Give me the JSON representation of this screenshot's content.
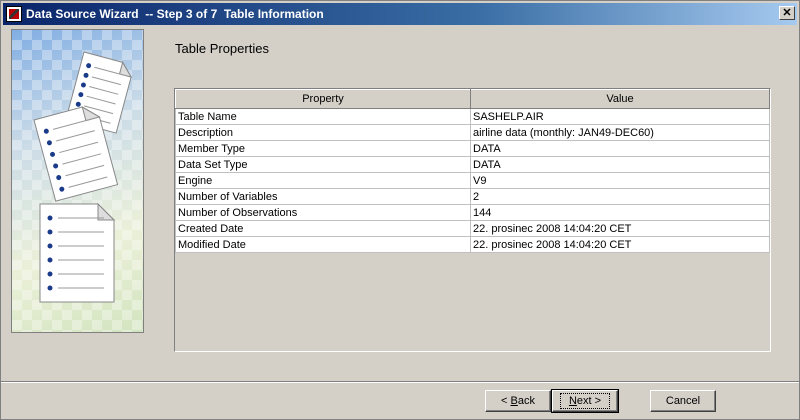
{
  "window": {
    "title": "Data Source Wizard  -- Step 3 of 7  Table Information",
    "close_label": "✕"
  },
  "heading": "Table Properties",
  "table": {
    "columns": [
      "Property",
      "Value"
    ],
    "rows": [
      [
        "Table Name",
        "SASHELP.AIR"
      ],
      [
        "Description",
        "airline data (monthly: JAN49-DEC60)"
      ],
      [
        "Member Type",
        "DATA"
      ],
      [
        "Data Set Type",
        "DATA"
      ],
      [
        "Engine",
        "V9"
      ],
      [
        "Number of Variables",
        "2"
      ],
      [
        "Number of Observations",
        "144"
      ],
      [
        "Created Date",
        "22. prosinec 2008 14:04:20 CET"
      ],
      [
        "Modified Date",
        "22. prosinec 2008 14:04:20 CET"
      ]
    ]
  },
  "buttons": {
    "back_pre": "< ",
    "back_hot": "B",
    "back_post": "ack",
    "next_hot": "N",
    "next_post": "ext >",
    "cancel": "Cancel"
  },
  "icons": {
    "app": "sas-app-icon",
    "close": "close-icon",
    "illustration": "document-stack-illustration"
  },
  "colors": {
    "titlebar_start": "#0a246a",
    "titlebar_end": "#a6caf0",
    "dialog_bg": "#d4d0c8",
    "bullet": "#1a3a8a"
  }
}
